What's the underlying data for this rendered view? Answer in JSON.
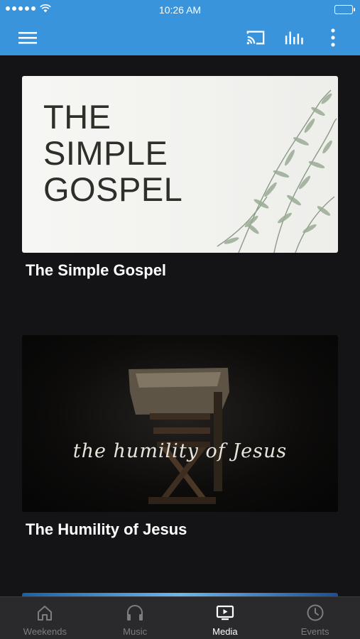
{
  "status_bar": {
    "time": "10:26 AM"
  },
  "app_bar": {
    "menu_icon": "hamburger-icon",
    "actions": [
      "cast-icon",
      "audio-bars-icon",
      "more-vertical-icon"
    ],
    "color": "#3a94dc"
  },
  "media": [
    {
      "title": "The Simple Gospel",
      "thumbnail_text": [
        "THE",
        "SIMPLE",
        "GOSPEL"
      ]
    },
    {
      "title": "The Humility of Jesus",
      "thumbnail_text": "the humility of Jesus"
    }
  ],
  "tabs": [
    {
      "label": "Weekends",
      "icon": "home-icon",
      "active": false
    },
    {
      "label": "Music",
      "icon": "headphones-icon",
      "active": false
    },
    {
      "label": "Media",
      "icon": "tv-play-icon",
      "active": true
    },
    {
      "label": "Events",
      "icon": "clock-icon",
      "active": false
    }
  ]
}
